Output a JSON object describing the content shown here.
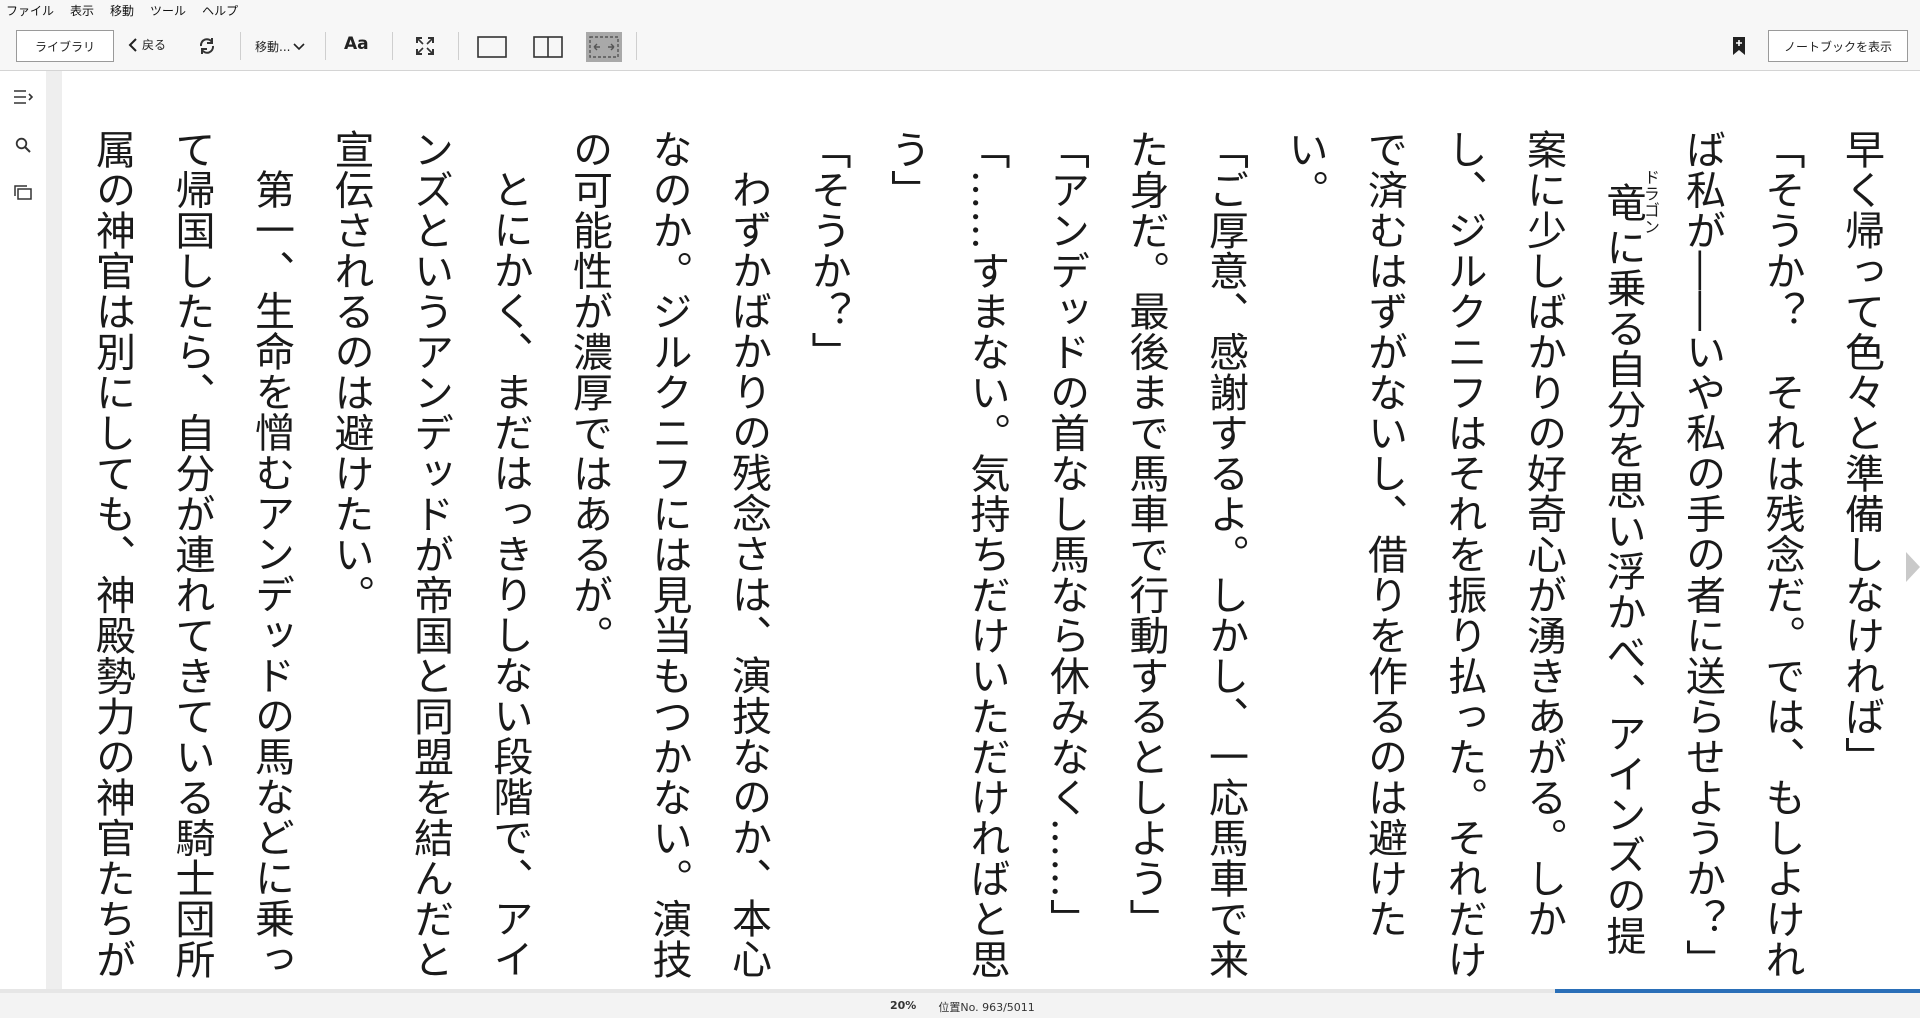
{
  "menu": [
    "ファイル",
    "表示",
    "移動",
    "ツール",
    "ヘルプ"
  ],
  "toolbar": {
    "library_label": "ライブラリ",
    "back_label": "戻る",
    "goto_label": "移動...",
    "font_label": "Aa",
    "notebook_label": "ノートブックを表示"
  },
  "book": {
    "paragraphs": [
      {
        "text": "早く帰って色々と準備しなければ」",
        "indent": false
      },
      {
        "text": "「そうか？　それは残念だ。では、もしよければ私が――いや私の手の者に送らせようか？」",
        "indent": false
      },
      {
        "text": "竜に乗る自分を思い浮かべ、アインズの提案に少しばかりの好奇心が湧きあがる。しかし、ジルクニフはそれを振り払った。それだけで済むはずがないし、借りを作るのは避けたい。",
        "indent": true
      },
      {
        "text": "「ご厚意、感謝するよ。しかし、一応馬車で来た身だ。最後まで馬車で行動するとしよう」",
        "indent": false
      },
      {
        "text": "「アンデッドの首なし馬なら休みなく……」",
        "indent": false
      },
      {
        "text": "「……すまない。気持ちだけいただければと思う」",
        "indent": false
      },
      {
        "text": "「そうか？」",
        "indent": false
      },
      {
        "text": "わずかばかりの残念さは、演技なのか、本心なのか。ジルクニフには見当もつかない。演技の可能性が濃厚ではあるが。",
        "indent": true
      },
      {
        "text": "とにかく、まだはっきりしない段階で、アインズというアンデッドが帝国と同盟を結んだと宣伝されるのは避けたい。",
        "indent": true
      },
      {
        "text": "第一、生命を憎むアンデッドの馬などに乗って帰国したら、自分が連れてきている騎士団所属の神官は別にしても、神殿勢力の神官たちが",
        "indent": true
      }
    ],
    "ruby_base": "竜",
    "ruby_text": "ドラゴン"
  },
  "status": {
    "percent": "20%",
    "location": "位置No. 963/5011",
    "progress_fraction": 0.19
  },
  "colors": {
    "progress": "#2a6fb8",
    "chrome": "#f7f7f7"
  },
  "icons": {
    "toc": "toc-icon",
    "search": "search-icon",
    "flashcards": "flashcards-icon",
    "refresh": "refresh-icon",
    "fullscreen": "fullscreen-icon",
    "bookmark": "bookmark-icon"
  }
}
